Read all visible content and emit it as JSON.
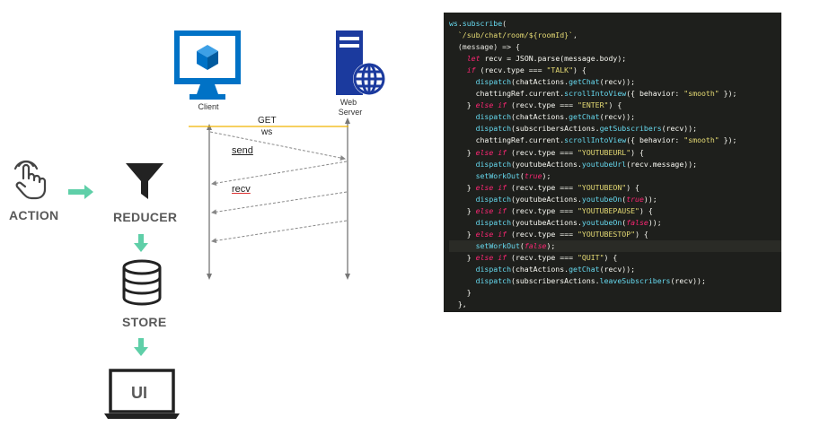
{
  "flow": {
    "action_label": "ACTION",
    "reducer_label": "REDUCER",
    "store_label": "STORE",
    "ui_label": "UI",
    "icons": [
      "hand-tap-icon",
      "funnel-icon",
      "database-icon",
      "laptop-icon",
      "arrow-right-icon",
      "arrow-down-icon"
    ],
    "arrow_color": "#5fcfa8",
    "text_color": "#595959"
  },
  "sequence": {
    "client_label": "Client",
    "server_label_1": "Web",
    "server_label_2": "Server",
    "get_label": "GET",
    "ws_label": "ws",
    "send_label": "send",
    "recv_label": "recv",
    "get_line_color": "#f0b400",
    "client_icon_color": "#0072c6",
    "server_icon_color": "#1b3a9e"
  },
  "code": {
    "lines": [
      "ws.subscribe(",
      "  `/sub/chat/room/${roomId}`,",
      "  (message) => {",
      "    let recv = JSON.parse(message.body);",
      "    if (recv.type === \"TALK\") {",
      "      dispatch(chatActions.getChat(recv));",
      "      chattingRef.current.scrollIntoView({ behavior: \"smooth\" });",
      "    } else if (recv.type === \"ENTER\") {",
      "      dispatch(chatActions.getChat(recv));",
      "      dispatch(subscribersActions.getSubscribers(recv));",
      "      chattingRef.current.scrollIntoView({ behavior: \"smooth\" });",
      "    } else if (recv.type === \"YOUTUBEURL\") {",
      "      dispatch(youtubeActions.youtubeUrl(recv.message));",
      "      setWorkOut(true);",
      "    } else if (recv.type === \"YOUTUBEON\") {",
      "      dispatch(youtubeActions.youtubeOn(true));",
      "    } else if (recv.type === \"YOUTUBEPAUSE\") {",
      "      dispatch(youtubeActions.youtubeOn(false));",
      "    } else if (recv.type === \"YOUTUBESTOP\") {",
      "      setWorkOut(false);",
      "    } else if (recv.type === \"QUIT\") {",
      "      dispatch(chatActions.getChat(recv));",
      "      dispatch(subscribersActions.leaveSubscribers(recv));",
      "    }",
      "  },"
    ]
  }
}
